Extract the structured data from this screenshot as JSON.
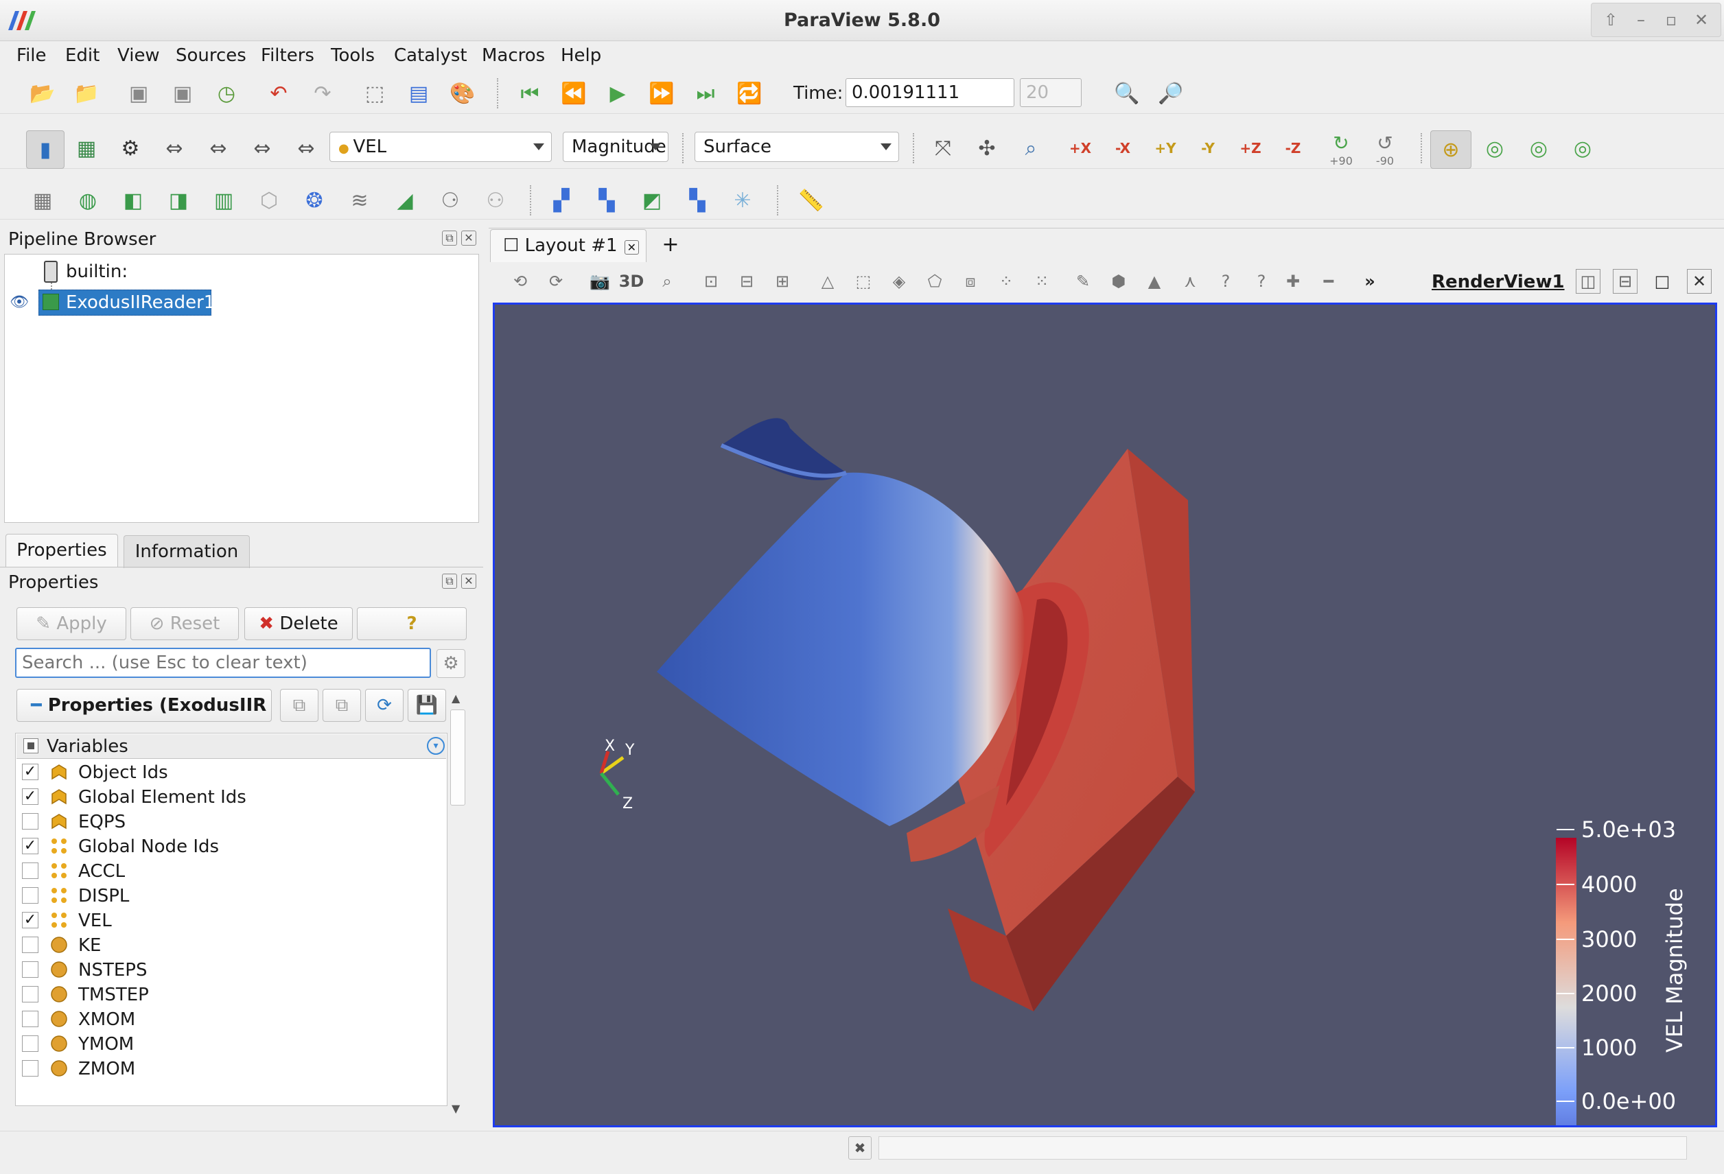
{
  "window": {
    "title": "ParaView 5.8.0"
  },
  "menu": [
    "File",
    "Edit",
    "View",
    "Sources",
    "Filters",
    "Tools",
    "Catalyst",
    "Macros",
    "Help"
  ],
  "time": {
    "label": "Time:",
    "value": "0.00191111",
    "step": "20"
  },
  "toolbar2": {
    "array": "VEL",
    "component": "Magnitude",
    "representation": "Surface",
    "axis_labels": [
      "+X",
      "-X",
      "+Y",
      "-Y",
      "+Z",
      "-Z"
    ],
    "rot_labels": [
      "+90",
      "-90"
    ]
  },
  "pipeline": {
    "title": "Pipeline Browser",
    "root": "builtin:",
    "reader": "ExodusIIReader1"
  },
  "tabs": {
    "properties": "Properties",
    "information": "Information"
  },
  "properties": {
    "title": "Properties",
    "apply": "Apply",
    "reset": "Reset",
    "delete": "Delete",
    "help": "?",
    "search_placeholder": "Search ... (use Esc to clear text)",
    "section": "Properties (ExodusIIR",
    "variables_header": "Variables",
    "variables": [
      {
        "name": "Object Ids",
        "checked": true,
        "kind": "cell"
      },
      {
        "name": "Global Element Ids",
        "checked": true,
        "kind": "cell"
      },
      {
        "name": "EQPS",
        "checked": false,
        "kind": "cell"
      },
      {
        "name": "Global Node Ids",
        "checked": true,
        "kind": "point"
      },
      {
        "name": "ACCL",
        "checked": false,
        "kind": "point"
      },
      {
        "name": "DISPL",
        "checked": false,
        "kind": "point"
      },
      {
        "name": "VEL",
        "checked": true,
        "kind": "point"
      },
      {
        "name": "KE",
        "checked": false,
        "kind": "global"
      },
      {
        "name": "NSTEPS",
        "checked": false,
        "kind": "global"
      },
      {
        "name": "TMSTEP",
        "checked": false,
        "kind": "global"
      },
      {
        "name": "XMOM",
        "checked": false,
        "kind": "global"
      },
      {
        "name": "YMOM",
        "checked": false,
        "kind": "global"
      },
      {
        "name": "ZMOM",
        "checked": false,
        "kind": "global"
      }
    ]
  },
  "layout": {
    "tab": "Layout #1",
    "add": "+",
    "view_name": "RenderView1",
    "mode_3d": "3D",
    "more": "»"
  },
  "colorbar": {
    "title": "VEL Magnitude",
    "labels": [
      "5.0e+03",
      "4000",
      "3000",
      "2000",
      "1000",
      "0.0e+00"
    ]
  },
  "axes": {
    "x": "X",
    "y": "Y",
    "z": "Z"
  },
  "colors": {
    "accent": "#1e3cf0",
    "background": "#51546c",
    "selection": "#2d7bc5",
    "blue": "#3a5fc8",
    "red": "#c8473a"
  }
}
